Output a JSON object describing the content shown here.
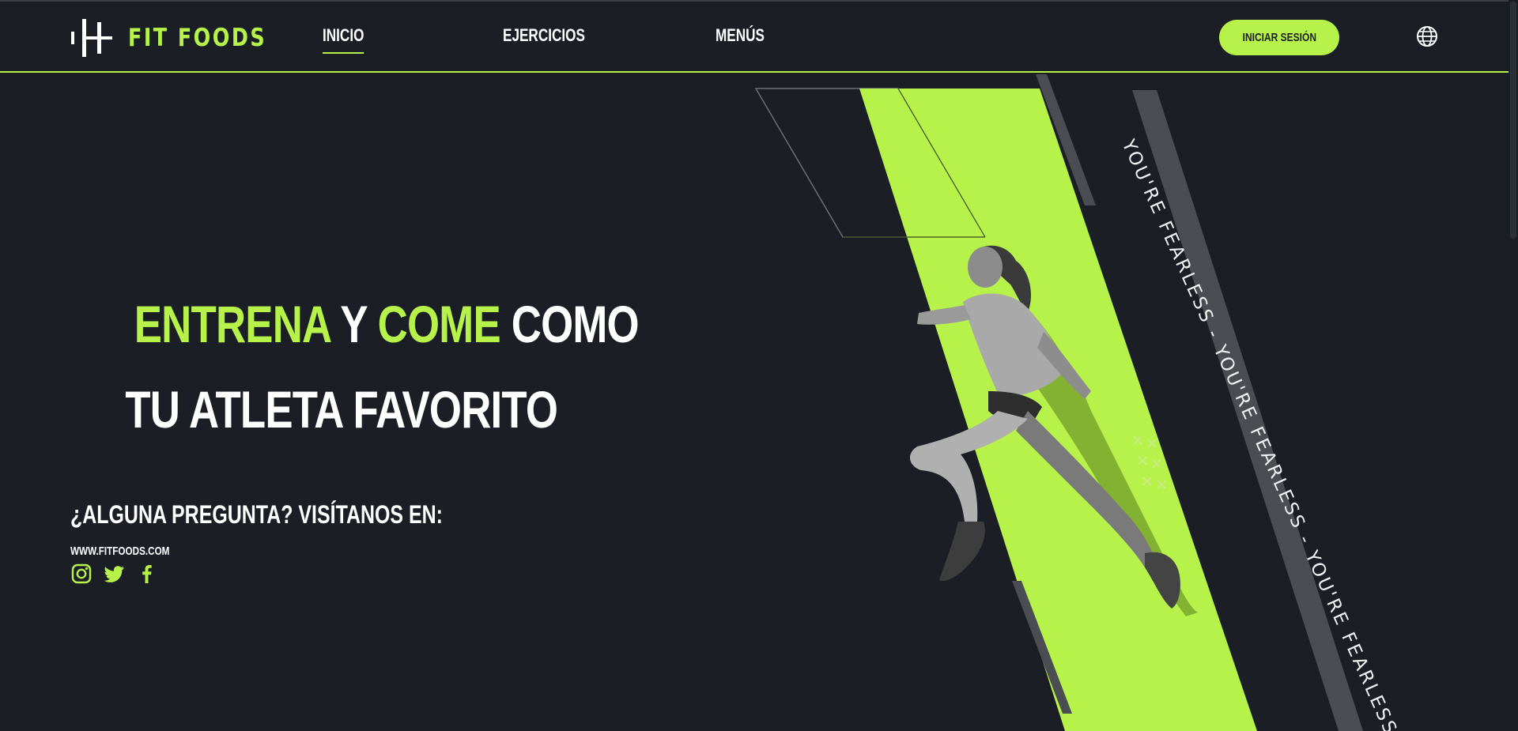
{
  "brand": {
    "name": "FIT FOODS",
    "logo_icon": "barbell-bars-icon"
  },
  "nav": {
    "items": [
      {
        "label": "INICIO",
        "active": true
      },
      {
        "label": "EJERCICIOS",
        "active": false
      },
      {
        "label": "MENÚS",
        "active": false
      }
    ],
    "login_label": "INICIAR SESIÓN",
    "language_icon": "globe-icon"
  },
  "hero": {
    "line1": {
      "word1": "ENTRENA",
      "word2": "Y",
      "word3": "COME",
      "word4": "COMO"
    },
    "line2": "TU ATLETA FAVORITO",
    "question": "¿ALGUNA PREGUNTA? VISÍTANOS EN:",
    "website": "WWW.FITFOODS.COM",
    "social_icons": [
      "instagram-icon",
      "twitter-icon",
      "facebook-icon"
    ],
    "side_text": "YOU'RE FEARLESS  -  YOU'RE FEARLESS  -  YOU'RE FEARLESS",
    "image_subject": "athlete-woman-running"
  },
  "colors": {
    "accent": "#b6f24a",
    "background": "#1b1f25",
    "stripe_gray": "#4a4d52",
    "text": "#ffffff"
  }
}
